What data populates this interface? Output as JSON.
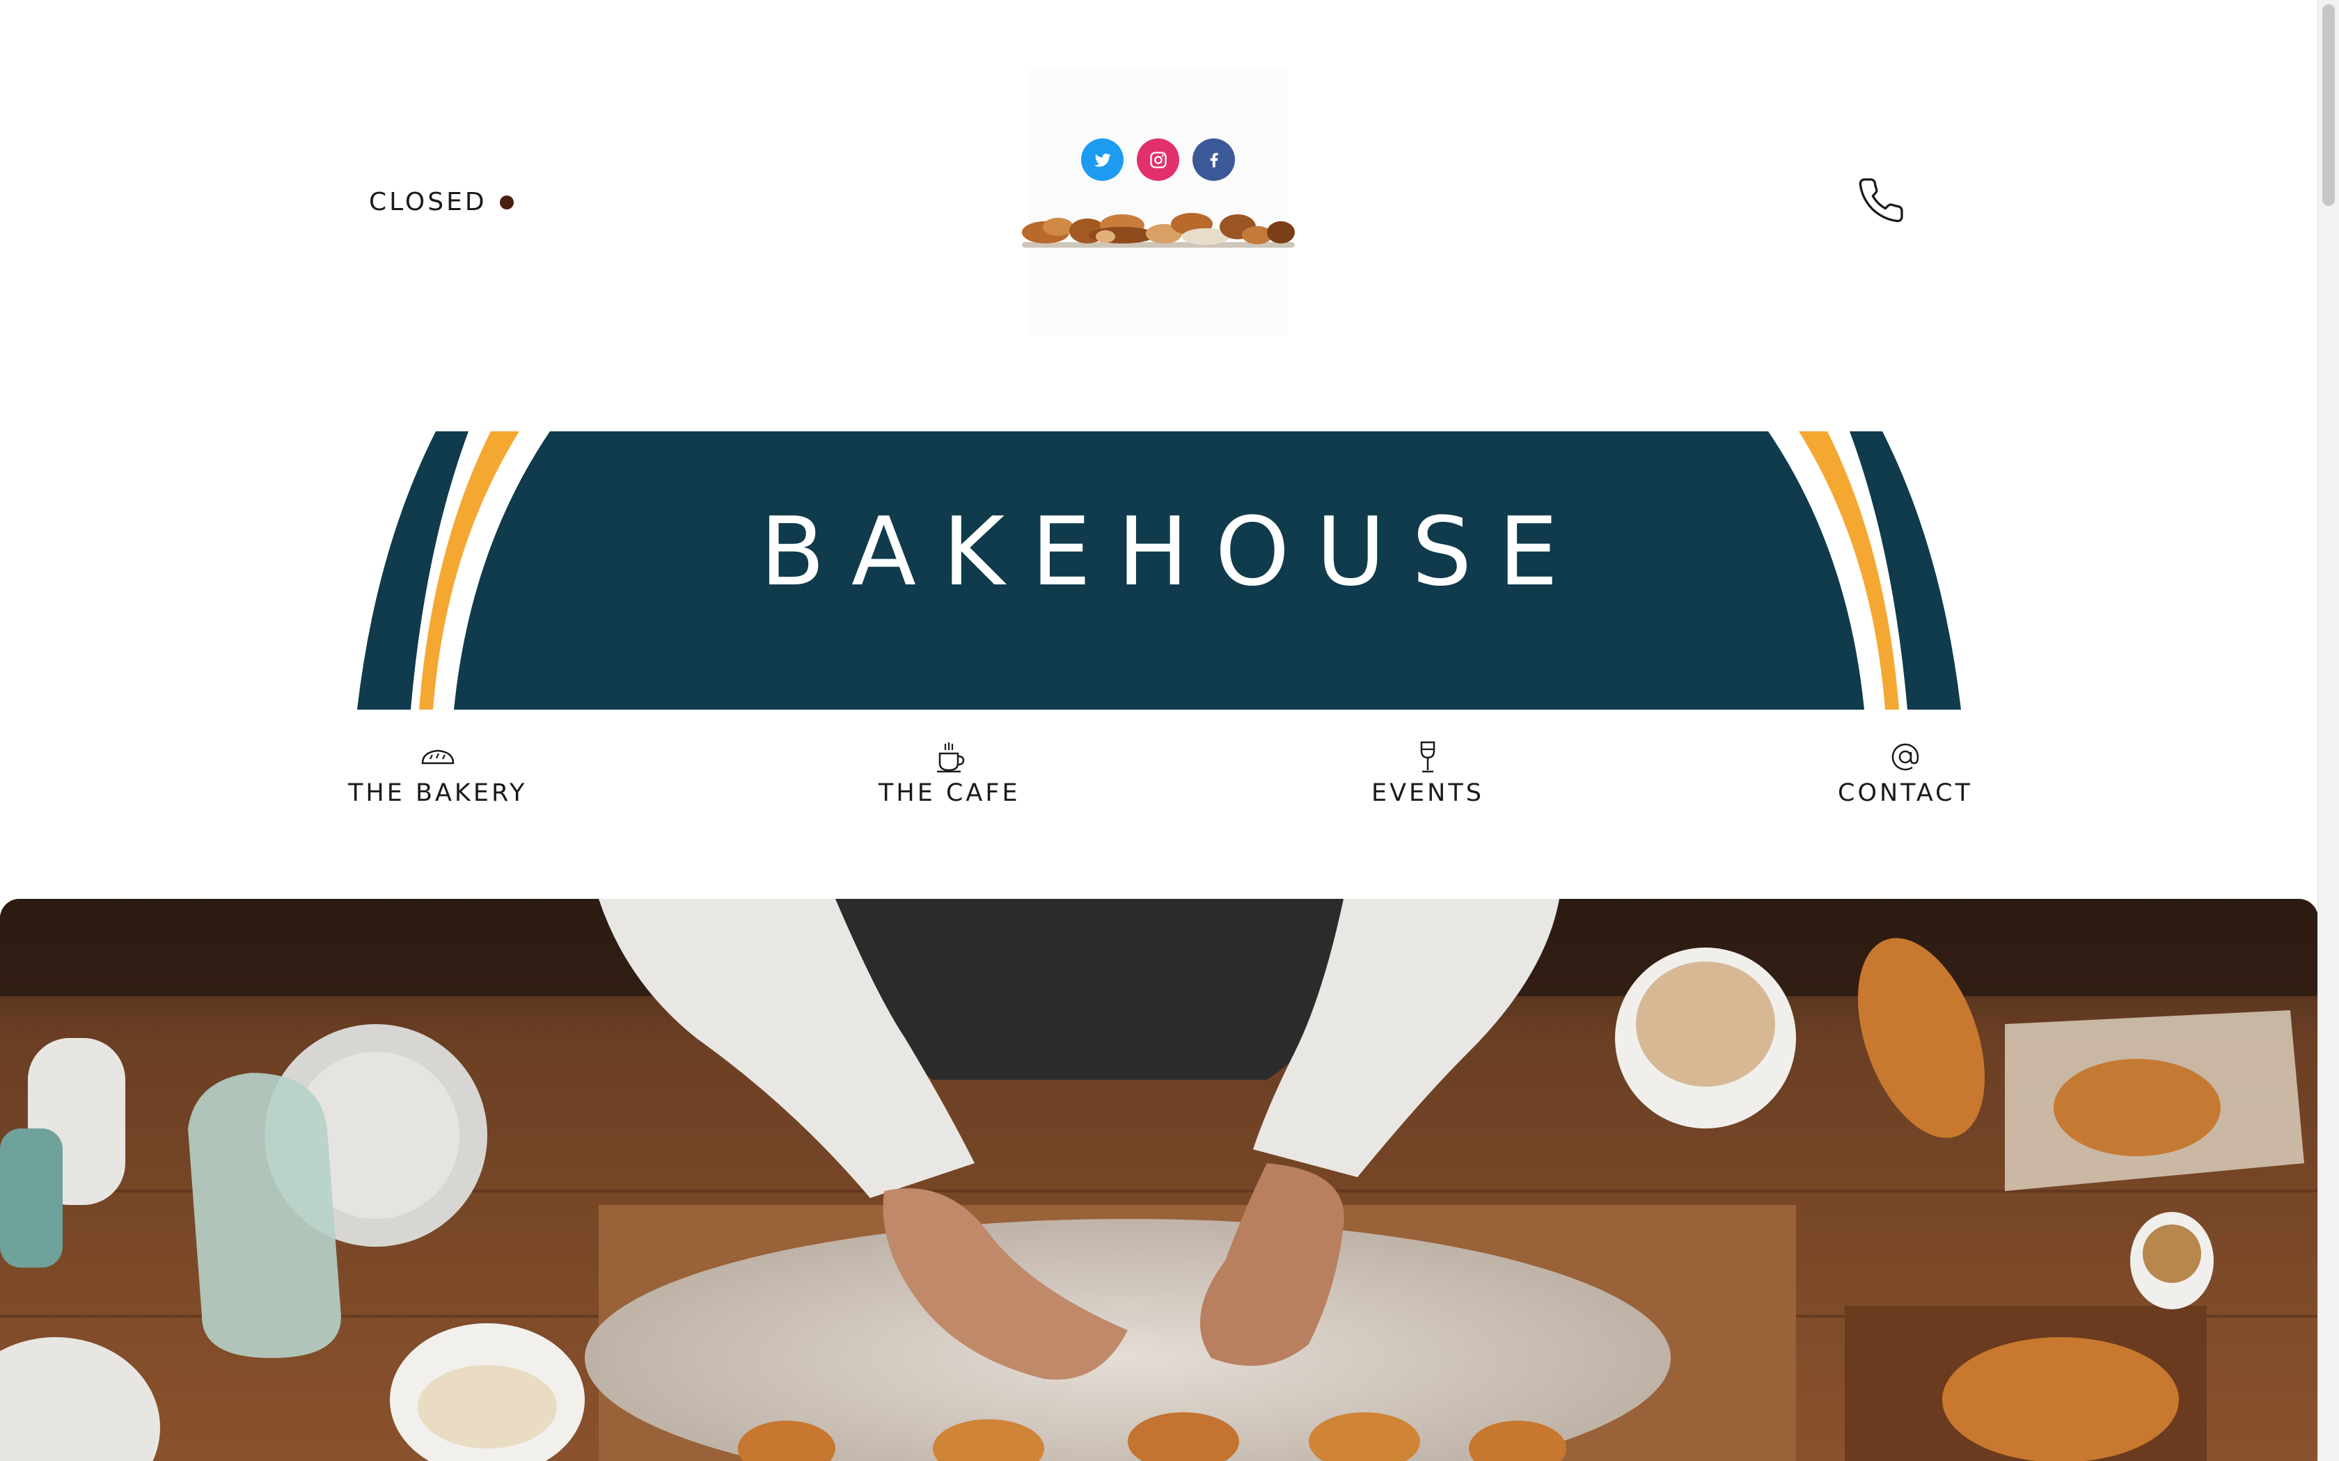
{
  "header": {
    "status_label": "CLOSED",
    "status_color": "#4a1f10",
    "social": [
      {
        "name": "twitter",
        "icon": "twitter-icon",
        "color": "#1d9bf0"
      },
      {
        "name": "instagram",
        "icon": "instagram-icon",
        "color": "#e1306c"
      },
      {
        "name": "facebook",
        "icon": "facebook-icon",
        "color": "#3b5998"
      }
    ],
    "logo_image": "bread-assortment-logo",
    "phone_icon": "phone-icon"
  },
  "banner": {
    "title": "BAKEHOUSE",
    "background_color": "#0f3b4c",
    "stripe_color": "#f4a832"
  },
  "nav": {
    "items": [
      {
        "label": "THE BAKERY",
        "icon": "bread-icon"
      },
      {
        "label": "THE CAFE",
        "icon": "coffee-cup-icon"
      },
      {
        "label": "EVENTS",
        "icon": "wine-glass-icon"
      },
      {
        "label": "CONTACT",
        "icon": "at-sign-icon"
      }
    ]
  },
  "hero": {
    "image": "baker-shaping-croissants-photo"
  }
}
